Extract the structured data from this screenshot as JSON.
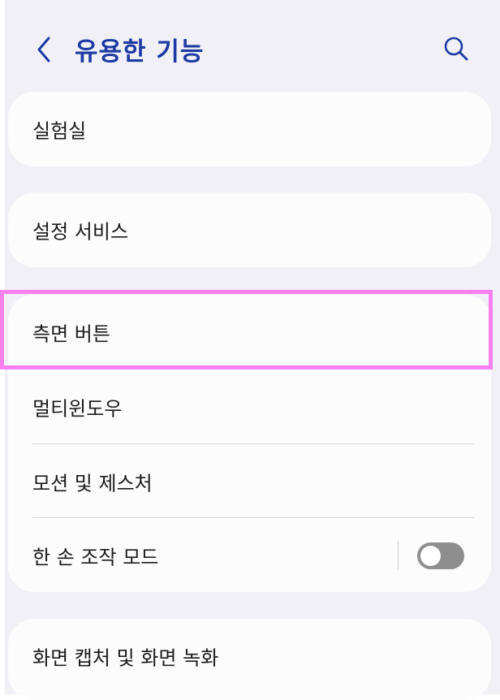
{
  "header": {
    "title": "유용한 기능",
    "back_icon": "chevron-left-icon",
    "search_icon": "search-icon"
  },
  "colors": {
    "accent": "#1d3aa3",
    "background": "#f0f0f6",
    "card": "#fcfcfc",
    "highlight": "#f77ff0",
    "toggle_off": "#8e8e8e"
  },
  "items": [
    {
      "label": "실험실"
    },
    {
      "label": "설정 서비스"
    },
    {
      "label": "측면 버튼"
    },
    {
      "label": "멀티윈도우"
    },
    {
      "label": "모션 및 제스처"
    },
    {
      "label": "한 손 조작 모드",
      "toggle": false
    },
    {
      "label": "화면 캡처 및 화면 녹화"
    }
  ]
}
